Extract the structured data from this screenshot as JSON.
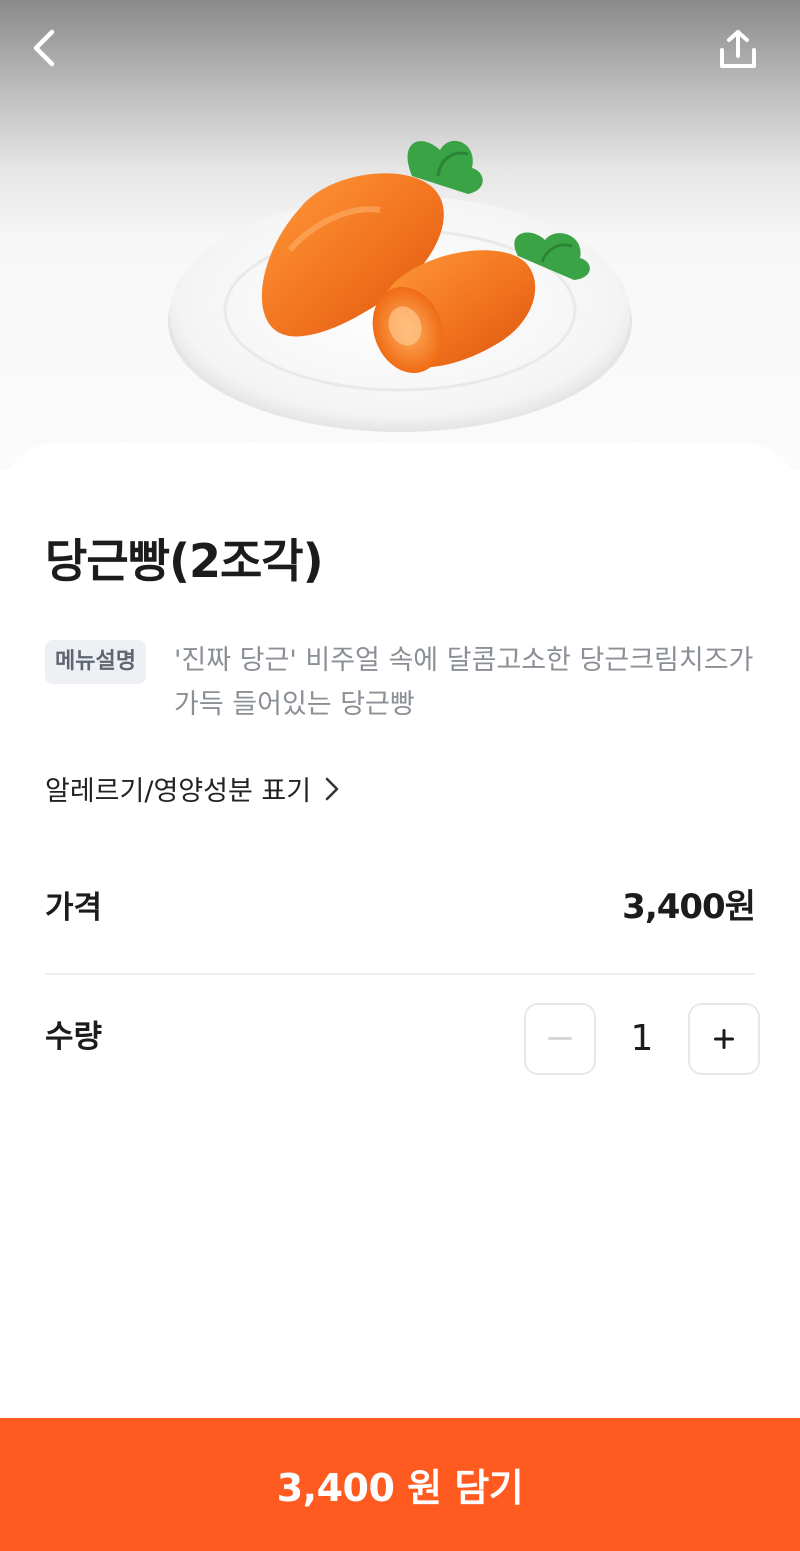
{
  "product": {
    "title": "당근빵(2조각)",
    "image_alt": "당근빵"
  },
  "description": {
    "badge": "메뉴설명",
    "text": "'진짜 당근' 비주얼 속에 달콤고소한 당근크림치즈가 가득 들어있는 당근빵"
  },
  "allergy_link": "알레르기/영양성분 표기",
  "price": {
    "label": "가격",
    "value": "3,400원"
  },
  "quantity": {
    "label": "수량",
    "value": "1",
    "minus": "−",
    "plus": "+"
  },
  "cta": {
    "label": "3,400 원 담기"
  },
  "colors": {
    "accent": "#ff5a1f",
    "badge_bg": "#eef0f4",
    "muted_text": "#8b8f96"
  },
  "icons": {
    "back": "chevron-left-icon",
    "share": "share-icon",
    "allergy": "chevron-right-icon"
  }
}
